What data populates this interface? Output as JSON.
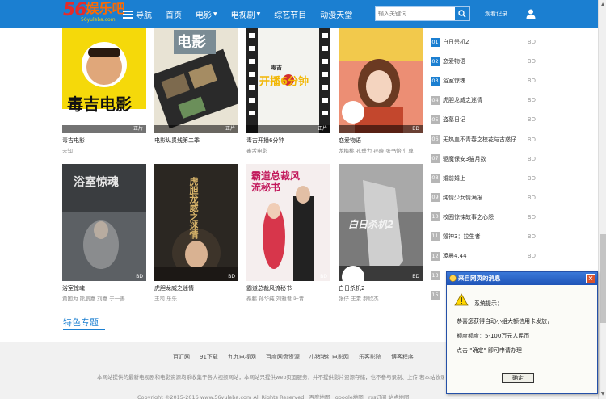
{
  "header": {
    "logo_number": "56",
    "logo_text": "娱乐吧",
    "logo_url": "56yuleba.com",
    "nav": [
      {
        "label": "导航",
        "has_caret": false
      },
      {
        "label": "首页",
        "has_caret": false
      },
      {
        "label": "电影",
        "has_caret": true
      },
      {
        "label": "电视剧",
        "has_caret": true
      },
      {
        "label": "综艺节目",
        "has_caret": false
      },
      {
        "label": "动漫天堂",
        "has_caret": false
      }
    ],
    "search_placeholder": "输入关键词",
    "history_label": "观看记录"
  },
  "movies_row1": [
    {
      "title": "毒吉电影",
      "sub": "未知",
      "badge": "正片"
    },
    {
      "title": "电影纵贯线第二季",
      "sub": "",
      "badge": "正片"
    },
    {
      "title": "毒吉开播6分钟",
      "sub": "毒舌电影",
      "badge": "正片"
    },
    {
      "title": "恋爱物语",
      "sub": "龙梅桃 孔垂力 孙晓 张书怡 仁尊",
      "badge": "BD"
    }
  ],
  "movies_row2": [
    {
      "title": "浴室惊魂",
      "sub": "黄国为 熊辰嘉 刘嘉 于一善",
      "badge": "BD"
    },
    {
      "title": "虎胆龙威之迷情",
      "sub": "王司 乐乐",
      "badge": "BD"
    },
    {
      "title": "霸道总裁风流秘书",
      "sub": "秦鹏 孙华纯 刘雅君 叶青",
      "badge": "BD"
    },
    {
      "title": "白日杀机2",
      "sub": "张仔 王素 郝欣杰",
      "badge": "BD"
    }
  ],
  "poster_texts": {
    "p1": "毒吉电影",
    "p2": "电影",
    "p3_top": "毒吉",
    "p3_main": "开播6分钟",
    "p5": "浴室惊魂",
    "p6": "虎胆龙威之迷情",
    "p7": "霸道总裁风流秘书",
    "p8": "白日杀机2"
  },
  "ranking": [
    {
      "num": "01",
      "title": "白日杀机2",
      "tag": "BD"
    },
    {
      "num": "02",
      "title": "恋爱物语",
      "tag": "BD"
    },
    {
      "num": "03",
      "title": "浴室惊魂",
      "tag": "BD"
    },
    {
      "num": "04",
      "title": "虎胆龙威之迷情",
      "tag": "BD"
    },
    {
      "num": "05",
      "title": "盗墓日记",
      "tag": "BD"
    },
    {
      "num": "06",
      "title": "无热血不青春之校花与古惑仔",
      "tag": "BD"
    },
    {
      "num": "07",
      "title": "驱魔保安3猫月数",
      "tag": "BD"
    },
    {
      "num": "08",
      "title": "婚前婚上",
      "tag": "BD"
    },
    {
      "num": "09",
      "title": "纯情少女情满报",
      "tag": "BD"
    },
    {
      "num": "10",
      "title": "校园惊悚故事之心怨",
      "tag": "BD"
    },
    {
      "num": "11",
      "title": "毁神3：拉生者",
      "tag": "BD"
    },
    {
      "num": "12",
      "title": "凌晨4.44",
      "tag": "BD"
    },
    {
      "num": "13",
      "title": "",
      "tag": "BD"
    },
    {
      "num": "15",
      "title": "",
      "tag": "BD"
    }
  ],
  "section": {
    "title": "特色专题"
  },
  "footer": {
    "links": [
      "百汇网",
      "91下载",
      "九九电视网",
      "百度网盘资源",
      "小猪猪红电影网",
      "乐客影院",
      "博客程序"
    ],
    "disclaimer": "本网站提供的最新电视剧和电影资源均系收集于各大视频网站，本网站只提供web页面服务，并不提供影片资源存储，也不参与录制、上传 若本站收录的节目无意侵犯了贵司版权，请给网页底部邮箱地址来信，我们会及时处理和回复，谢谢",
    "copyright": "Copyright ©2015-2016 www.56yuleba.com All Rights Reserved · 百度地图 · google地图 · rss订阅 站点地图"
  },
  "dialog": {
    "title": "来自网页的消息",
    "line1": "系统提示：",
    "line2": "恭喜您获得自动小组大额信用卡发放，",
    "line3": "额度额度：5-100万元人民币",
    "line4": "点击 \"确定\" 即可申请办理",
    "ok_label": "确定"
  },
  "colors": {
    "brand": "#1b7fd1",
    "logo_red": "#e52b2b",
    "logo_orange": "#ff6a00"
  }
}
